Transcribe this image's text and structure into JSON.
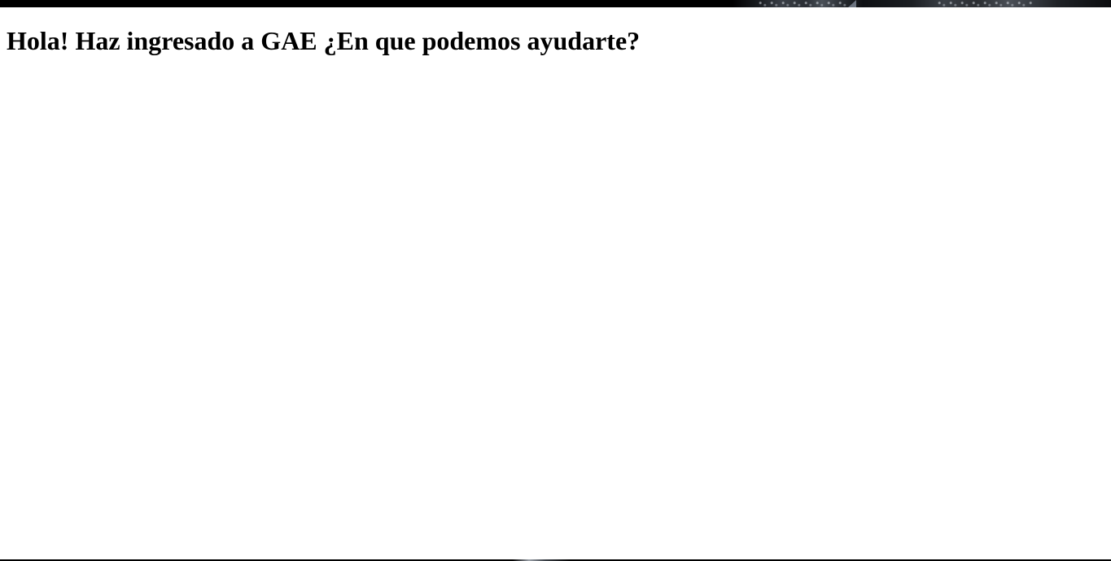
{
  "header": {
    "banner_image": "dark-speckled-banner-image"
  },
  "main": {
    "welcome_heading": "Hola! Haz ingresado a GAE ¿En que podemos ayudarte?"
  },
  "footer": {
    "banner_image": "dark-banner-image"
  },
  "colors": {
    "background": "#ffffff",
    "text": "#000000",
    "banner": "#000000"
  }
}
